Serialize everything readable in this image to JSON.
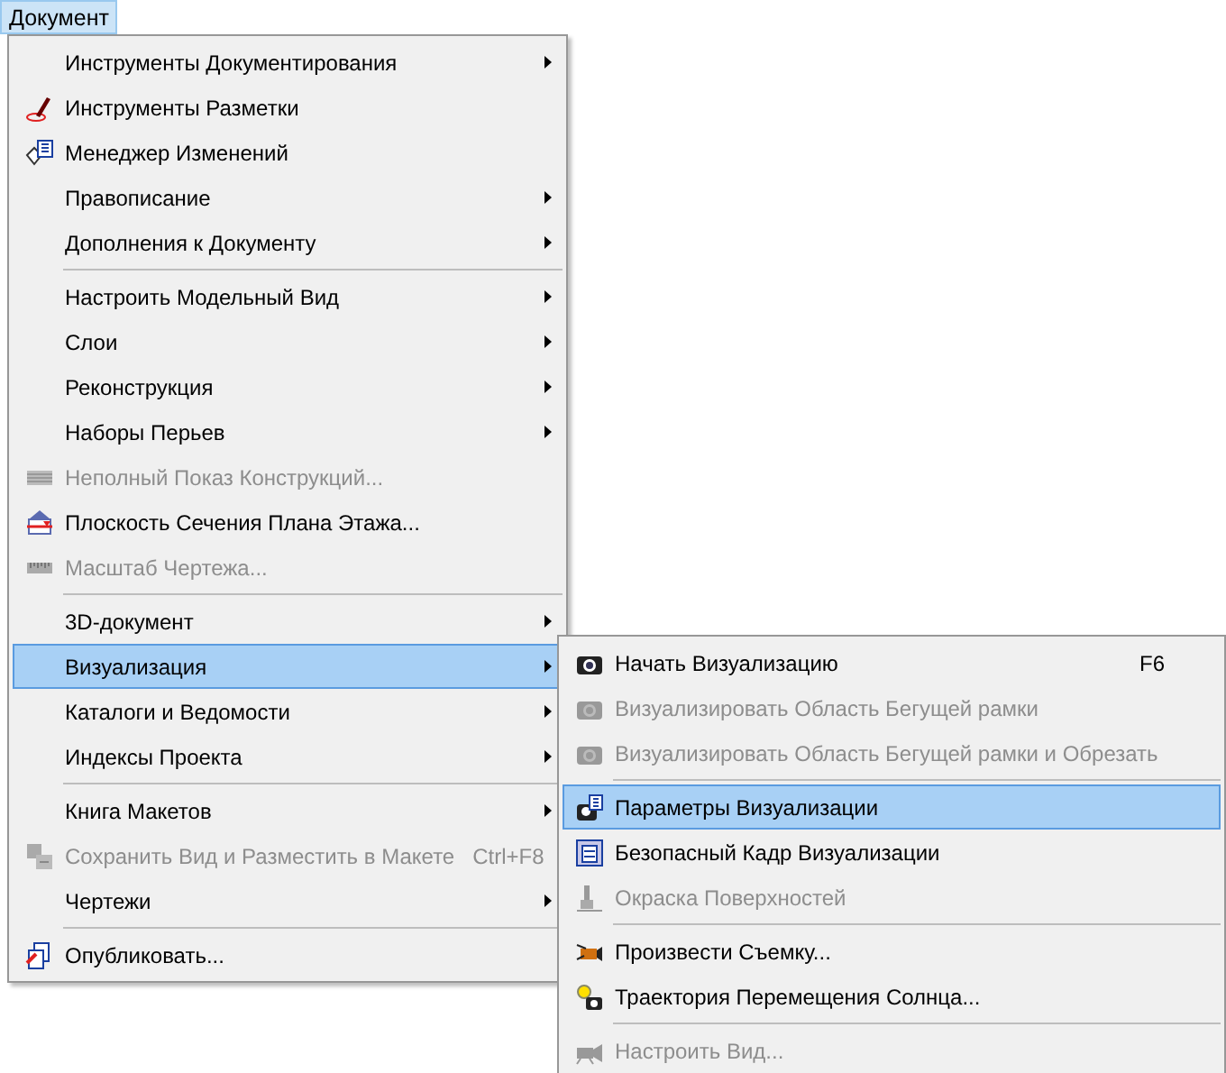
{
  "menubar": {
    "items": [
      {
        "label": "Документ",
        "selected": true
      }
    ]
  },
  "menu": {
    "entries": [
      {
        "kind": "item",
        "label": "Инструменты Документирования",
        "submenu": true,
        "disabled": false,
        "selected": false
      },
      {
        "kind": "item",
        "label": "Инструменты Разметки",
        "submenu": false,
        "disabled": false,
        "selected": false
      },
      {
        "kind": "item",
        "label": "Менеджер Изменений",
        "submenu": false,
        "disabled": false,
        "selected": false
      },
      {
        "kind": "item",
        "label": "Правописание",
        "submenu": true,
        "disabled": false,
        "selected": false
      },
      {
        "kind": "item",
        "label": "Дополнения к Документу",
        "submenu": true,
        "disabled": false,
        "selected": false
      },
      {
        "kind": "separator"
      },
      {
        "kind": "item",
        "label": "Настроить Модельный Вид",
        "submenu": true,
        "disabled": false,
        "selected": false
      },
      {
        "kind": "item",
        "label": "Слои",
        "submenu": true,
        "disabled": false,
        "selected": false
      },
      {
        "kind": "item",
        "label": "Реконструкция",
        "submenu": true,
        "disabled": false,
        "selected": false
      },
      {
        "kind": "item",
        "label": "Наборы Перьев",
        "submenu": true,
        "disabled": false,
        "selected": false
      },
      {
        "kind": "item",
        "label": "Неполный Показ Конструкций...",
        "submenu": false,
        "disabled": true,
        "selected": false
      },
      {
        "kind": "item",
        "label": "Плоскость Сечения Плана Этажа...",
        "submenu": false,
        "disabled": false,
        "selected": false
      },
      {
        "kind": "item",
        "label": "Масштаб Чертежа...",
        "submenu": false,
        "disabled": true,
        "selected": false
      },
      {
        "kind": "separator"
      },
      {
        "kind": "item",
        "label": "3D-документ",
        "submenu": true,
        "disabled": false,
        "selected": false
      },
      {
        "kind": "item",
        "label": "Визуализация",
        "submenu": true,
        "disabled": false,
        "selected": true
      },
      {
        "kind": "item",
        "label": "Каталоги и Ведомости",
        "submenu": true,
        "disabled": false,
        "selected": false
      },
      {
        "kind": "item",
        "label": "Индексы Проекта",
        "submenu": true,
        "disabled": false,
        "selected": false
      },
      {
        "kind": "separator"
      },
      {
        "kind": "item",
        "label": "Книга Макетов",
        "submenu": true,
        "disabled": false,
        "selected": false
      },
      {
        "kind": "item",
        "label": "Сохранить Вид и Разместить в Макете",
        "shortcut": "Ctrl+F8",
        "submenu": false,
        "disabled": true,
        "selected": false
      },
      {
        "kind": "item",
        "label": "Чертежи",
        "submenu": true,
        "disabled": false,
        "selected": false
      },
      {
        "kind": "separator"
      },
      {
        "kind": "item",
        "label": "Опубликовать...",
        "submenu": false,
        "disabled": false,
        "selected": false
      }
    ]
  },
  "submenu": {
    "entries": [
      {
        "kind": "item",
        "label": "Начать Визуализацию",
        "shortcut": "F6",
        "disabled": false,
        "selected": false
      },
      {
        "kind": "item",
        "label": "Визуализировать Область Бегущей рамки",
        "disabled": true,
        "selected": false
      },
      {
        "kind": "item",
        "label": "Визуализировать Область Бегущей рамки и Обрезать",
        "disabled": true,
        "selected": false
      },
      {
        "kind": "separator"
      },
      {
        "kind": "item",
        "label": "Параметры Визуализации",
        "disabled": false,
        "selected": true
      },
      {
        "kind": "item",
        "label": "Безопасный Кадр Визуализации",
        "disabled": false,
        "selected": false
      },
      {
        "kind": "item",
        "label": "Окраска Поверхностей",
        "disabled": true,
        "selected": false
      },
      {
        "kind": "separator"
      },
      {
        "kind": "item",
        "label": "Произвести Съемку...",
        "disabled": false,
        "selected": false
      },
      {
        "kind": "item",
        "label": "Траектория Перемещения Солнца...",
        "disabled": false,
        "selected": false
      },
      {
        "kind": "separator"
      },
      {
        "kind": "item",
        "label": "Настроить Вид...",
        "disabled": true,
        "selected": false
      }
    ]
  }
}
